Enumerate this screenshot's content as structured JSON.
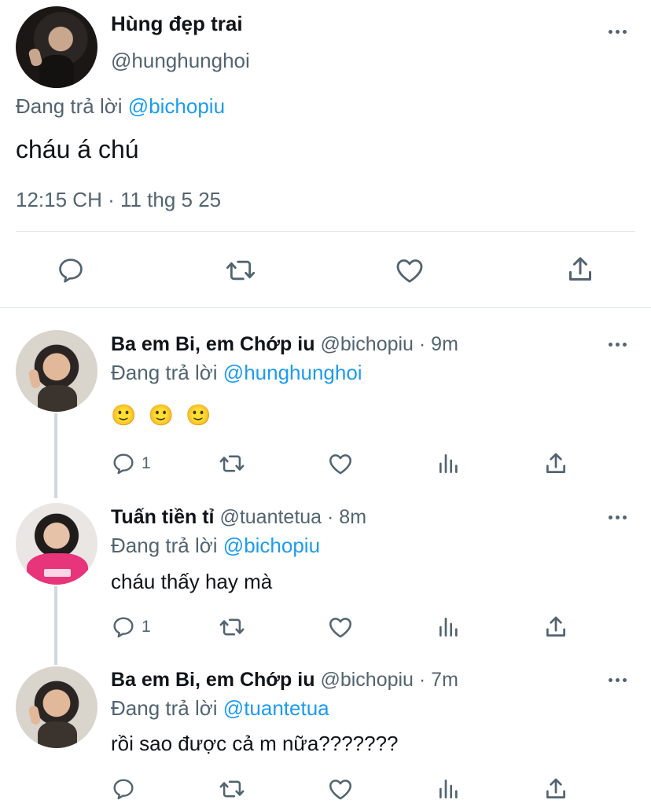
{
  "main_tweet": {
    "display_name": "Hùng đẹp trai",
    "handle": "@hunghunghoi",
    "reply_prefix": "Đang trả lời",
    "reply_to": "@bichopiu",
    "text": "cháu á chú",
    "timestamp": "12:15 CH · 11 thg 5 25"
  },
  "replies": [
    {
      "display_name": "Ba em Bi, em Chớp iu",
      "meta": "@bichopiu · 9m",
      "reply_prefix": "Đang trả lời",
      "reply_to": "@hunghunghoi",
      "text": "🙂 🙂 🙂",
      "reply_count": "1"
    },
    {
      "display_name": "Tuấn tiền tỉ",
      "meta": "@tuantetua · 8m",
      "reply_prefix": "Đang trả lời",
      "reply_to": "@bichopiu",
      "text": "cháu thấy hay mà",
      "reply_count": "1"
    },
    {
      "display_name": "Ba em Bi, em Chớp iu",
      "meta": "@bichopiu · 7m",
      "reply_prefix": "Đang trả lời",
      "reply_to": "@tuantetua",
      "text": "rồi sao được cả m nữa???????",
      "reply_count": ""
    }
  ],
  "colors": {
    "text": "#0f1419",
    "muted": "#536471",
    "link": "#1d9bf0",
    "divider": "#e1e8ed"
  },
  "icons": [
    "reply-icon",
    "retweet-icon",
    "like-icon",
    "share-icon",
    "views-icon",
    "more-icon"
  ]
}
